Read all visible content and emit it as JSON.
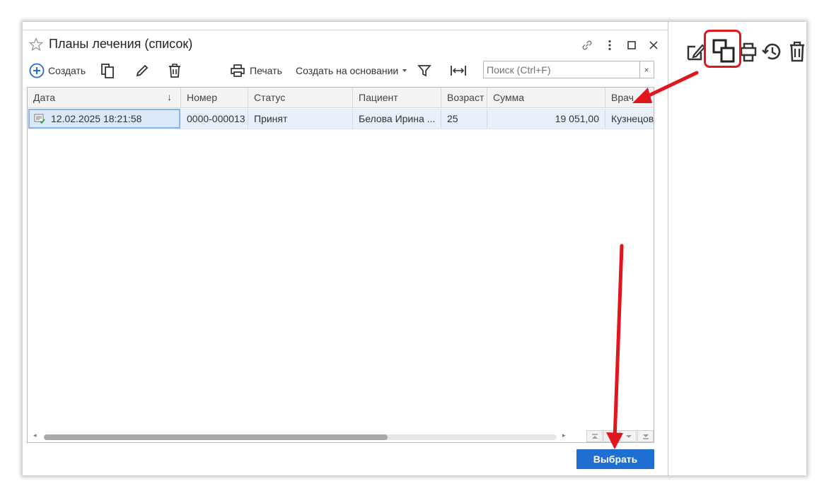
{
  "window": {
    "title": "Планы лечения (список)"
  },
  "toolbar": {
    "create_label": "Создать",
    "print_label": "Печать",
    "create_based_label": "Создать на основании",
    "search_placeholder": "Поиск (Ctrl+F)",
    "search_clear": "×"
  },
  "grid": {
    "columns": [
      "Дата",
      "Номер",
      "Статус",
      "Пациент",
      "Возраст",
      "Сумма",
      "Врач"
    ],
    "sort_indicator": "↓",
    "rows": [
      {
        "date": "12.02.2025 18:21:58",
        "number": "0000-000013",
        "status": "Принят",
        "patient": "Белова Ирина ...",
        "age": "25",
        "sum": "19 051,00",
        "doctor": "Кузнецова"
      }
    ]
  },
  "footer": {
    "select_label": "Выбрать"
  },
  "colors": {
    "accent": "#1e6fd1",
    "annotation": "#e0151d",
    "selected_row": "#e8f0fb"
  },
  "icons": {
    "bg_toolbar": [
      "edit-icon",
      "copy-icon",
      "print-icon",
      "history-icon",
      "delete-icon"
    ],
    "window": [
      "star-icon",
      "link-icon",
      "more-icon",
      "maximize-icon",
      "close-icon"
    ]
  }
}
